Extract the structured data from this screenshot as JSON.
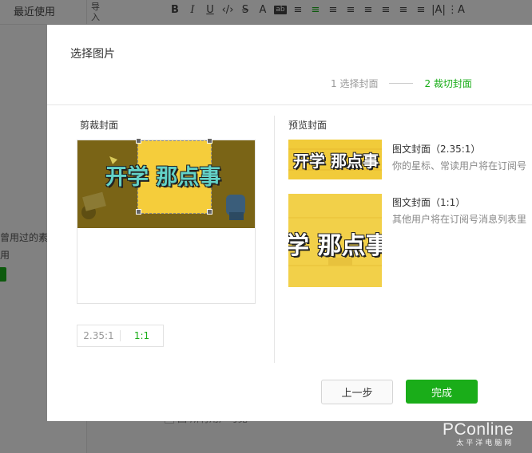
{
  "background": {
    "recent_label": "最近使用",
    "import_label": "导入",
    "toolbar": [
      "B",
      "I",
      "U",
      "‹/›",
      "S",
      "A",
      "ab",
      "≡",
      "≡",
      "≡",
      "≡",
      "≡",
      "≡",
      "≡",
      "≡",
      "|A|",
      "⋮A"
    ],
    "left_text_1": "曾用过的素",
    "left_text_2": "用",
    "bottom_text": "回 所有用户可见"
  },
  "dialog": {
    "title": "选择图片",
    "steps": [
      {
        "label": "1 选择封面",
        "active": false
      },
      {
        "label": "2 裁切封面",
        "active": true
      }
    ],
    "crop": {
      "label": "剪裁封面",
      "image_text": "开学 那点事",
      "ratio_options": [
        {
          "label": "2.35:1",
          "selected": false
        },
        {
          "label": "1:1",
          "selected": true
        }
      ]
    },
    "preview": {
      "label": "预览封面",
      "items": [
        {
          "name": "图文封面（2.35:1）",
          "desc": "你的星标、常读用户将在订阅号",
          "thumb_text": "开学 那点事"
        },
        {
          "name": "图文封面（1:1）",
          "desc": "其他用户将在订阅号消息列表里",
          "thumb_text": "学 那点事"
        }
      ]
    },
    "buttons": {
      "prev_label": "上一步",
      "done_label": "完成"
    }
  },
  "watermark": {
    "main": "PConline",
    "sub": "太平洋电脑网"
  },
  "colors": {
    "accent": "#1aad19",
    "overlay": "rgba(0,0,0,0.48)",
    "cover_yellow": "#f5cd3b"
  }
}
